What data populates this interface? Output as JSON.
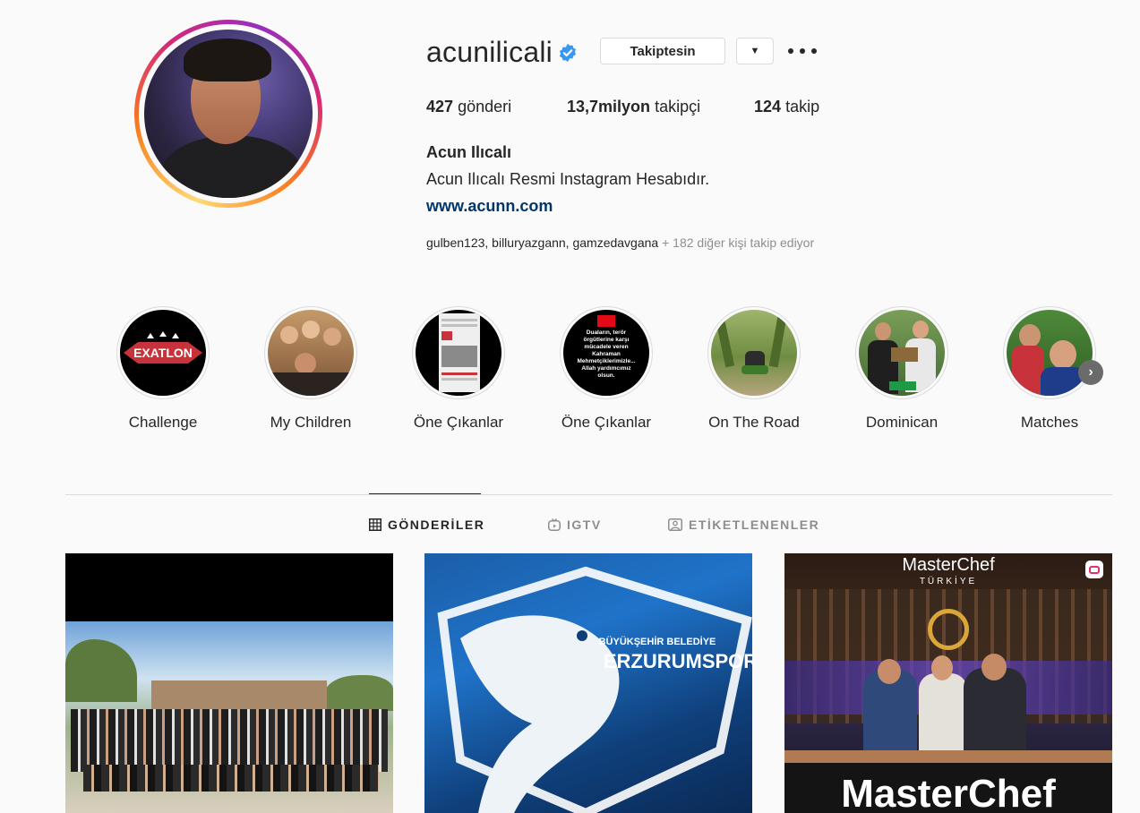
{
  "profile": {
    "username": "acunilicali",
    "follow_button": "Takiptesin",
    "stats": {
      "posts_value": "427",
      "posts_label": "gönderi",
      "followers_value": "13,7milyon",
      "followers_label": "takipçi",
      "following_value": "124",
      "following_label": "takip"
    },
    "full_name": "Acun Ilıcalı",
    "bio": "Acun Ilıcalı Resmi Instagram Hesabıdır.",
    "website": "www.acunn.com",
    "followed_by_names": "gulben123, billuryazgann, gamzedavgana",
    "followed_by_more": " + 182 diğer kişi takip ediyor"
  },
  "highlights": [
    {
      "label": "Challenge",
      "icon": "exatlon-logo"
    },
    {
      "label": "My Children",
      "icon": "photo"
    },
    {
      "label": "Öne Çıkanlar",
      "icon": "newspaper"
    },
    {
      "label": "Öne Çıkanlar",
      "icon": "text-post"
    },
    {
      "label": "On The Road",
      "icon": "motorbike-photo"
    },
    {
      "label": "Dominican",
      "icon": "photo"
    },
    {
      "label": "Matches",
      "icon": "photo"
    }
  ],
  "highlight_texts": {
    "exatlon": "EXATLON",
    "newspaper_headline": "2002'de ... ",
    "text_post": "Duaların, terör örgütlerine karşı mücadele veren Kahraman Mehmetçiklerimizle... Allah yardımcımız olsun."
  },
  "tabs": [
    {
      "label": "GÖNDERİLER",
      "active": true,
      "icon": "grid-icon"
    },
    {
      "label": "IGTV",
      "active": false,
      "icon": "igtv-icon"
    },
    {
      "label": "ETİKETLENENLER",
      "active": false,
      "icon": "tagged-icon"
    }
  ],
  "posts": [
    {
      "kind": "group-photo"
    },
    {
      "kind": "club-logo",
      "text_top": "BÜYÜKŞEHİR BELEDİYE",
      "text_main": "ERZURUMSPOR"
    },
    {
      "kind": "tv-show",
      "brand": "MasterChef",
      "sub": "TÜRKİYE",
      "bottom": "MasterChef"
    }
  ],
  "colors": {
    "link": "#00376b",
    "muted": "#8e8e8e",
    "verified": "#3897f0"
  }
}
